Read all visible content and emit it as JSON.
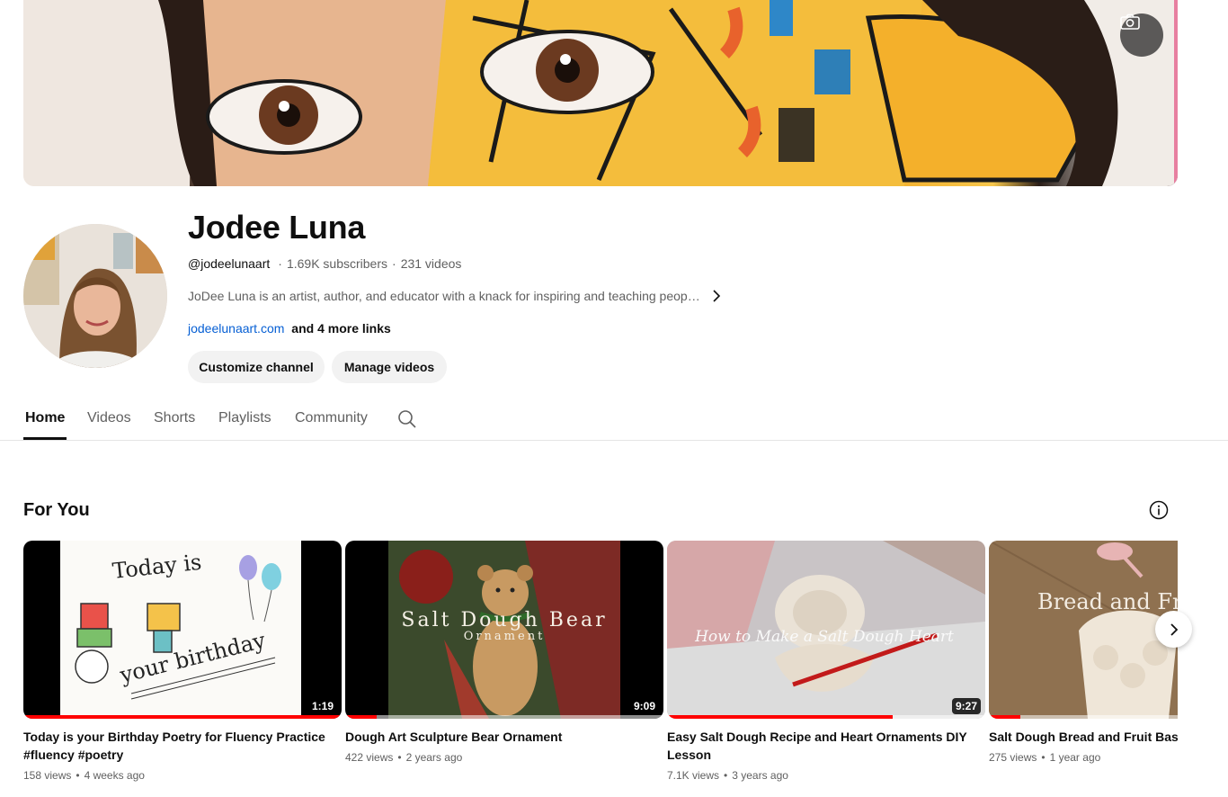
{
  "channel": {
    "name": "Jodee Luna",
    "handle": "@jodeelunaart",
    "subscribers": "1.69K subscribers",
    "videos_count": "231 videos",
    "description": "JoDee Luna is an artist, author, and educator with a knack for inspiring and teaching peopl…",
    "link": "jodeelunaart.com",
    "more_links": "and 4 more links"
  },
  "buttons": {
    "customize": "Customize channel",
    "manage": "Manage videos"
  },
  "tabs": [
    {
      "label": "Home",
      "active": true
    },
    {
      "label": "Videos",
      "active": false
    },
    {
      "label": "Shorts",
      "active": false
    },
    {
      "label": "Playlists",
      "active": false
    },
    {
      "label": "Community",
      "active": false
    }
  ],
  "section": {
    "title": "For You"
  },
  "videos": [
    {
      "title": "Today is your Birthday Poetry for Fluency Practice #fluency #poetry",
      "duration": "1:19",
      "views": "158 views",
      "age": "4 weeks ago",
      "watched_fraction": 1.0,
      "thumb_text_1": "Today is",
      "thumb_text_2": "your birthday"
    },
    {
      "title": "Dough Art Sculpture Bear Ornament",
      "duration": "9:09",
      "views": "422 views",
      "age": "2 years ago",
      "watched_fraction": 0.1,
      "thumb_text_1": "Salt Dough Bear",
      "thumb_text_2": "Ornament"
    },
    {
      "title": "Easy Salt Dough Recipe and Heart Ornaments DIY Lesson",
      "duration": "9:27",
      "views": "7.1K views",
      "age": "3 years ago",
      "watched_fraction": 0.71,
      "thumb_text_1": "How to Make a Salt Dough Heart"
    },
    {
      "title": "Salt Dough Bread and Fruit Baske",
      "views": "275 views",
      "age": "1 year ago",
      "watched_fraction": 0.1,
      "thumb_text_1": "Bread and Frui"
    }
  ],
  "colors": {
    "progress": "#ff0000",
    "link": "#065fd4"
  }
}
